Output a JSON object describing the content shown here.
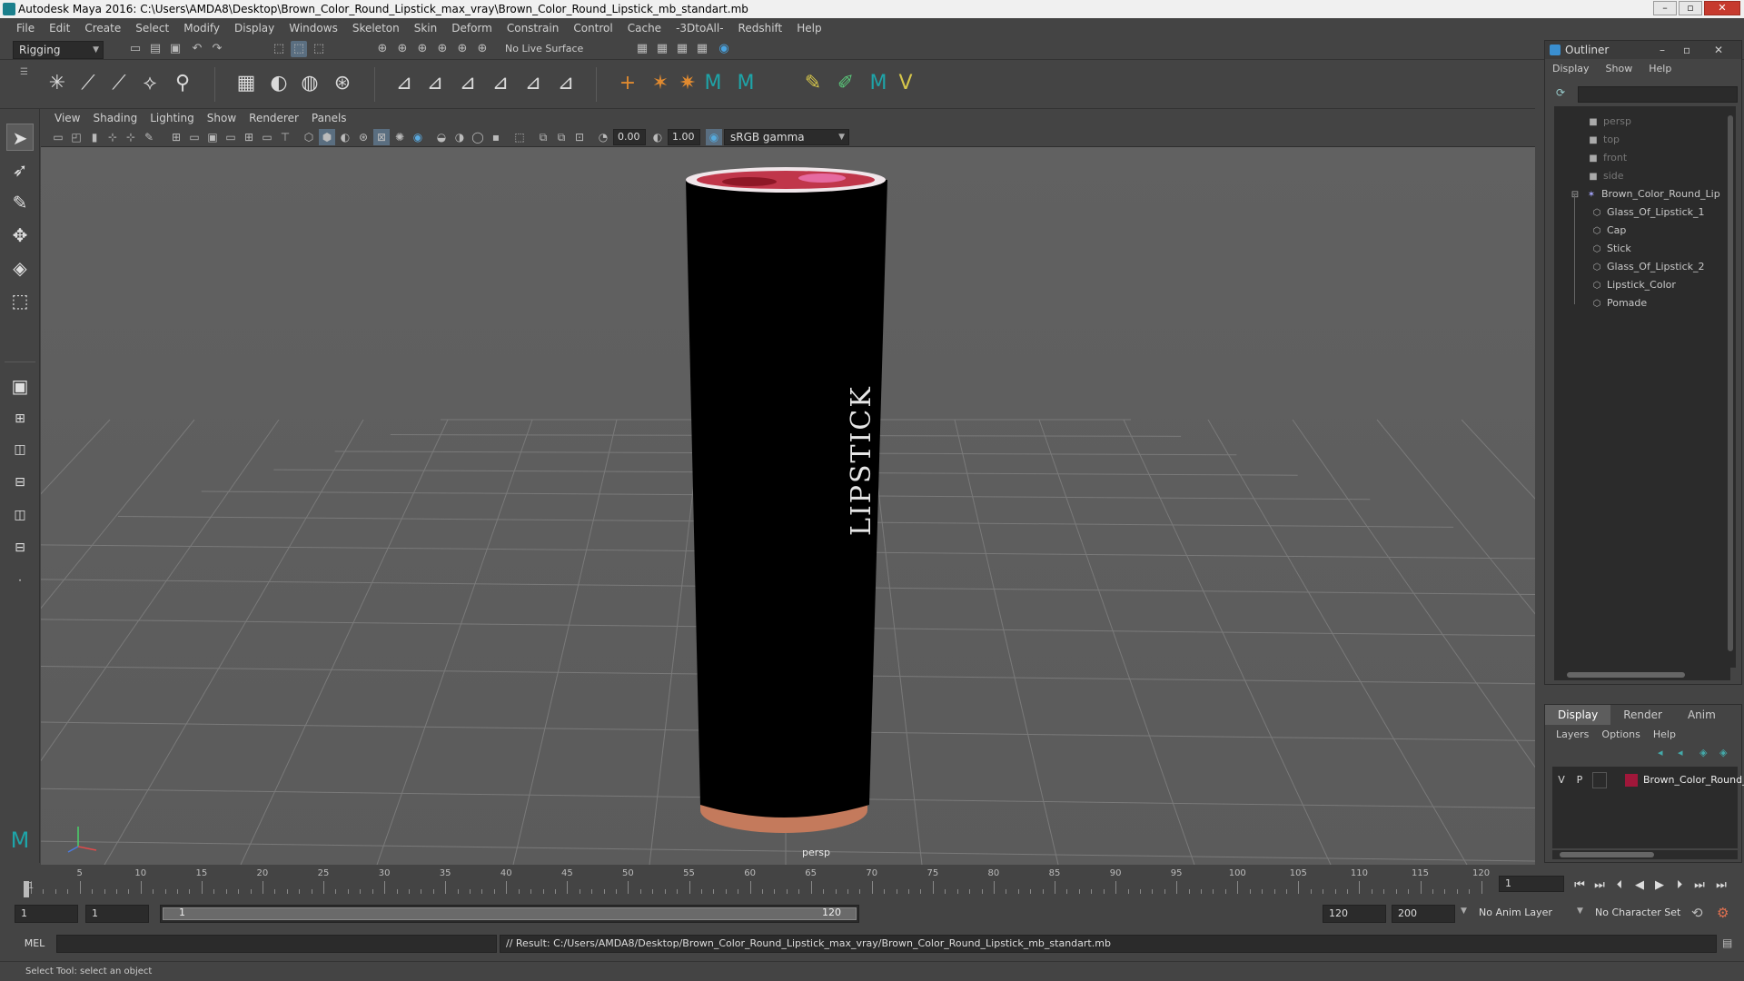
{
  "window": {
    "title": "Autodesk Maya 2016: C:\\Users\\AMDA8\\Desktop\\Brown_Color_Round_Lipstick_max_vray\\Brown_Color_Round_Lipstick_mb_standart.mb"
  },
  "menubar": [
    "File",
    "Edit",
    "Create",
    "Select",
    "Modify",
    "Display",
    "Windows",
    "Skeleton",
    "Skin",
    "Deform",
    "Constrain",
    "Control",
    "Cache",
    "-3DtoAll-",
    "Redshift",
    "Help"
  ],
  "statusline": {
    "mode": "Rigging",
    "live_surface": "No Live Surface"
  },
  "panel": {
    "menu": [
      "View",
      "Shading",
      "Lighting",
      "Show",
      "Renderer",
      "Panels"
    ],
    "exposure": "0.00",
    "gamma": "1.00",
    "colorspace": "sRGB gamma",
    "camera": "persp"
  },
  "model": {
    "label": "LIPSTICK",
    "colors": {
      "body": "#000000",
      "base": "#c47a5c",
      "top": "#c0364a"
    }
  },
  "outliner": {
    "title": "Outliner",
    "menu": [
      "Display",
      "Show",
      "Help"
    ],
    "cameras": [
      "persp",
      "top",
      "front",
      "side"
    ],
    "group": "Brown_Color_Round_Lip",
    "children": [
      "Glass_Of_Lipstick_1",
      "Cap",
      "Stick",
      "Glass_Of_Lipstick_2",
      "Lipstick_Color",
      "Pomade"
    ]
  },
  "layer_editor": {
    "tabs": [
      "Display",
      "Render",
      "Anim"
    ],
    "menu": [
      "Layers",
      "Options",
      "Help"
    ],
    "layer": {
      "v": "V",
      "p": "P",
      "name": "Brown_Color_Round_l",
      "color": "#a0173a"
    }
  },
  "timeline": {
    "ticks": [
      "5",
      "10",
      "15",
      "20",
      "25",
      "30",
      "35",
      "40",
      "45",
      "50",
      "55",
      "60",
      "65",
      "70",
      "75",
      "80",
      "85",
      "90",
      "95",
      "100",
      "105",
      "110",
      "115",
      "120"
    ],
    "first_tick": "1",
    "current_frame": "1"
  },
  "range": {
    "start": "1",
    "playback_start": "1",
    "slider_start": "1",
    "slider_end": "120",
    "playback_end": "120",
    "end": "200",
    "anim_layer": "No Anim Layer",
    "character_set": "No Character Set"
  },
  "cmdline": {
    "language": "MEL",
    "result": "// Result: C:/Users/AMDA8/Desktop/Brown_Color_Round_Lipstick_max_vray/Brown_Color_Round_Lipstick_mb_standart.mb"
  },
  "helpline": "Select Tool: select an object"
}
